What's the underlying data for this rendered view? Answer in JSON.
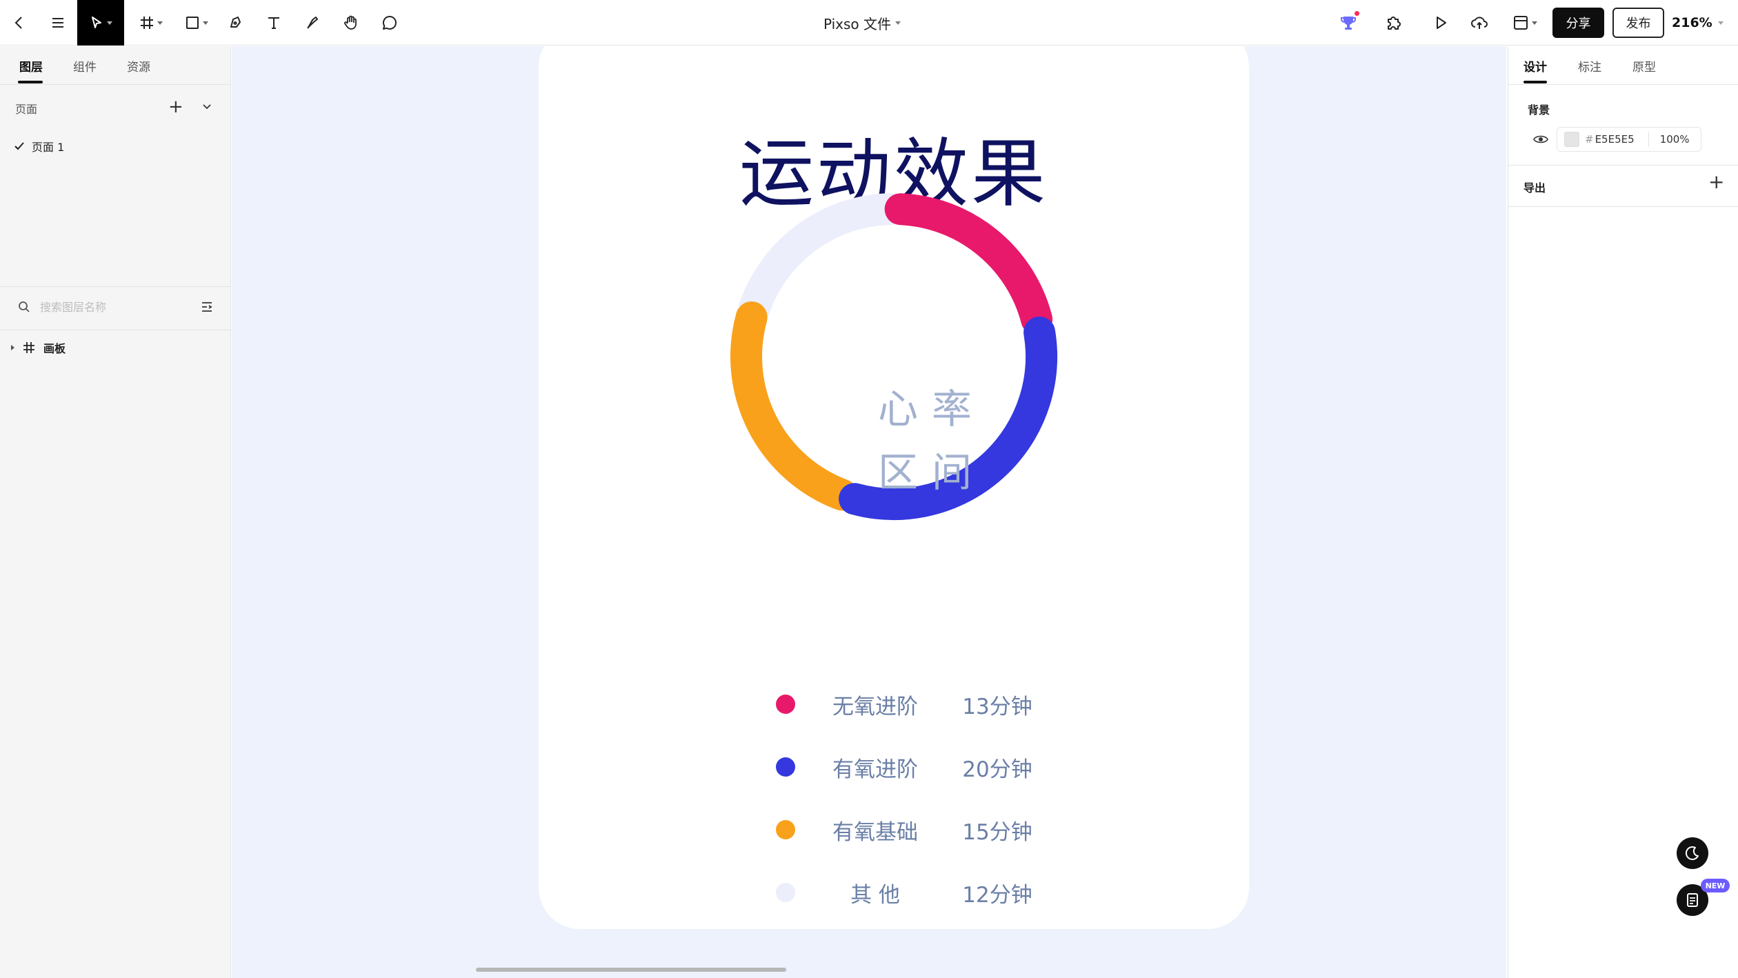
{
  "toolbar": {
    "file_title": "Pixso 文件",
    "share_label": "分享",
    "publish_label": "发布",
    "zoom_label": "216%",
    "icons": [
      "back-icon",
      "menu-icon",
      "move-icon",
      "frame-icon",
      "rectangle-icon",
      "pen-icon",
      "text-icon",
      "pencil-icon",
      "hand-icon",
      "comment-icon",
      "ai-trophy-icon",
      "plugin-icon",
      "play-icon",
      "upload-icon",
      "layout-icon"
    ]
  },
  "left_panel": {
    "tabs": [
      "图层",
      "组件",
      "资源"
    ],
    "active_tab": "图层",
    "pages_header": "页面",
    "pages": [
      "页面 1"
    ],
    "search_placeholder": "搜索图层名称",
    "layers": [
      "画板"
    ]
  },
  "artboard": {
    "title": "运动效果",
    "center_line1": "心率",
    "center_line2": "区间",
    "legend": [
      {
        "name": "无氧进阶",
        "time": "13分钟",
        "color": "#e8196b"
      },
      {
        "name": "有氧进阶",
        "time": "20分钟",
        "color": "#3438de"
      },
      {
        "name": "有氧基础",
        "time": "15分钟",
        "color": "#f9a11b"
      },
      {
        "name": "其 他",
        "time": "12分钟",
        "color": "#eceefb"
      }
    ]
  },
  "chart_data": {
    "type": "pie",
    "categories": [
      "无氧进阶",
      "有氧进阶",
      "有氧基础",
      "其 他"
    ],
    "values": [
      13,
      20,
      15,
      12
    ],
    "unit": "分钟",
    "colors": [
      "#e8196b",
      "#3438de",
      "#f9a11b",
      "#eceefb"
    ]
  },
  "right_panel": {
    "tabs": [
      "设计",
      "标注",
      "原型"
    ],
    "active_tab": "设计",
    "background_title": "背景",
    "background_hash": "#",
    "background_hex": "E5E5E5",
    "background_opacity": "100%",
    "export_title": "导出",
    "new_badge": "NEW"
  },
  "colors": {
    "canvas_bg": "#eef2fd",
    "title_navy": "#0f1260",
    "legend_text": "#6a7fa6"
  }
}
